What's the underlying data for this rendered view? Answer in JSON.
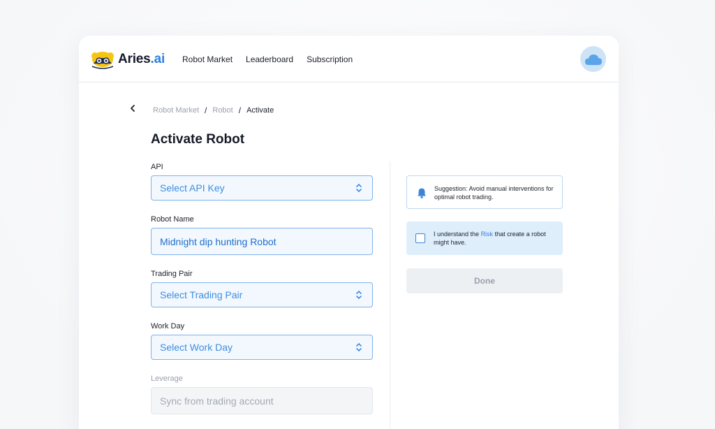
{
  "app": {
    "brand": "Aries",
    "tld": ".ai"
  },
  "nav": {
    "items": [
      "Robot Market",
      "Leaderboard",
      "Subscription"
    ]
  },
  "breadcrumb": {
    "items": [
      "Robot Market",
      "Robot",
      "Activate"
    ],
    "separator": "/"
  },
  "page": {
    "title": "Activate Robot"
  },
  "form": {
    "api": {
      "label": "API",
      "value": "Select API Key"
    },
    "robot_name": {
      "label": "Robot Name",
      "value": "Midnight dip hunting Robot"
    },
    "trading_pair": {
      "label": "Trading Pair",
      "value": "Select Trading Pair"
    },
    "work_day": {
      "label": "Work Day",
      "value": "Select Work Day"
    },
    "leverage": {
      "label": "Leverage",
      "value": "Sync from trading account"
    }
  },
  "side": {
    "suggestion": "Suggestion: Avoid manual interventions for optimal robot trading.",
    "consent_prefix": "I understand the ",
    "consent_link": "Risk",
    "consent_suffix": " that create a robot might have.",
    "done_label": "Done"
  },
  "colors": {
    "accent": "#2f7fe0",
    "field_border": "#7fb2ea",
    "field_bg": "#f3f8fe",
    "consent_bg": "#dfeefb",
    "avatar_bg": "#cfe3f7"
  },
  "icons": [
    "logo-mark-icon",
    "cloud-icon",
    "chevron-left-icon",
    "stepper-icon",
    "bell-icon"
  ]
}
